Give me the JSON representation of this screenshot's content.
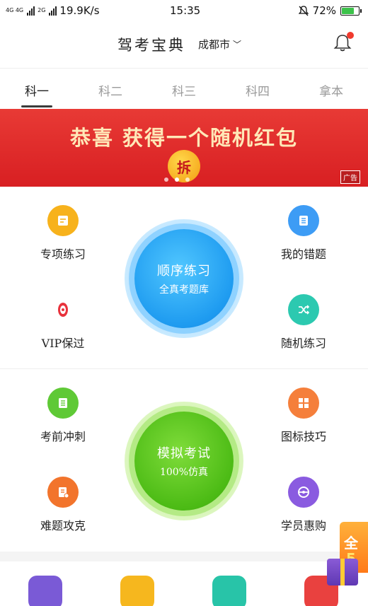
{
  "status_bar": {
    "network": "4G 4G",
    "network2": "2G",
    "speed": "19.9K/s",
    "time": "15:35",
    "battery": "72%",
    "battery_level": 0.72
  },
  "header": {
    "title": "驾考宝典",
    "city": "成都市",
    "city_chevron": "﹀"
  },
  "tabs": [
    {
      "label": "科一",
      "active": true
    },
    {
      "label": "科二",
      "active": false
    },
    {
      "label": "科三",
      "active": false
    },
    {
      "label": "科四",
      "active": false
    },
    {
      "label": "拿本",
      "active": false
    }
  ],
  "banner": {
    "text": "恭喜 获得一个随机红包",
    "badge": "拆",
    "ad_tag": "广告",
    "pages": 3,
    "active_page": 1
  },
  "practice": {
    "items": [
      {
        "label": "专项练习",
        "icon": "edit-note-icon",
        "color": "#f7b21c"
      },
      {
        "label": "我的错题",
        "icon": "list-note-icon",
        "color": "#3d9cf5"
      },
      {
        "label": "VIP保过",
        "icon": "vip-badge-icon",
        "color": "#e8323c"
      },
      {
        "label": "随机练习",
        "icon": "shuffle-icon",
        "color": "#2cc9b0"
      }
    ],
    "center_title": "顺序练习",
    "center_subtitle": "全真考题库"
  },
  "exam": {
    "items": [
      {
        "label": "考前冲刺",
        "icon": "document-list-icon",
        "color": "#5fc936"
      },
      {
        "label": "图标技巧",
        "icon": "grid-icon",
        "color": "#f57f3b"
      },
      {
        "label": "难题攻克",
        "icon": "document-pencil-icon",
        "color": "#f2742c"
      },
      {
        "label": "学员惠购",
        "icon": "steering-wheel-icon",
        "color": "#8a5be0"
      }
    ],
    "center_title": "模拟考试",
    "center_subtitle": "100%仿真"
  },
  "bottom_row": [
    {
      "icon": "star-badge-icon",
      "color": "#7a5ad6"
    },
    {
      "icon": "camera-icon",
      "color": "#f6b71e"
    },
    {
      "icon": "document-lines-icon",
      "color": "#28c4a8"
    },
    {
      "icon": "shopping-bag-icon",
      "color": "#e9413f"
    }
  ],
  "float_ad": {
    "line1": "全",
    "line2": "5"
  },
  "colors": {
    "banner_red": "#e02a2a",
    "banner_text": "#ffe8b8",
    "practice_blue": "#1e9bf0",
    "exam_green": "#4cbb15"
  }
}
